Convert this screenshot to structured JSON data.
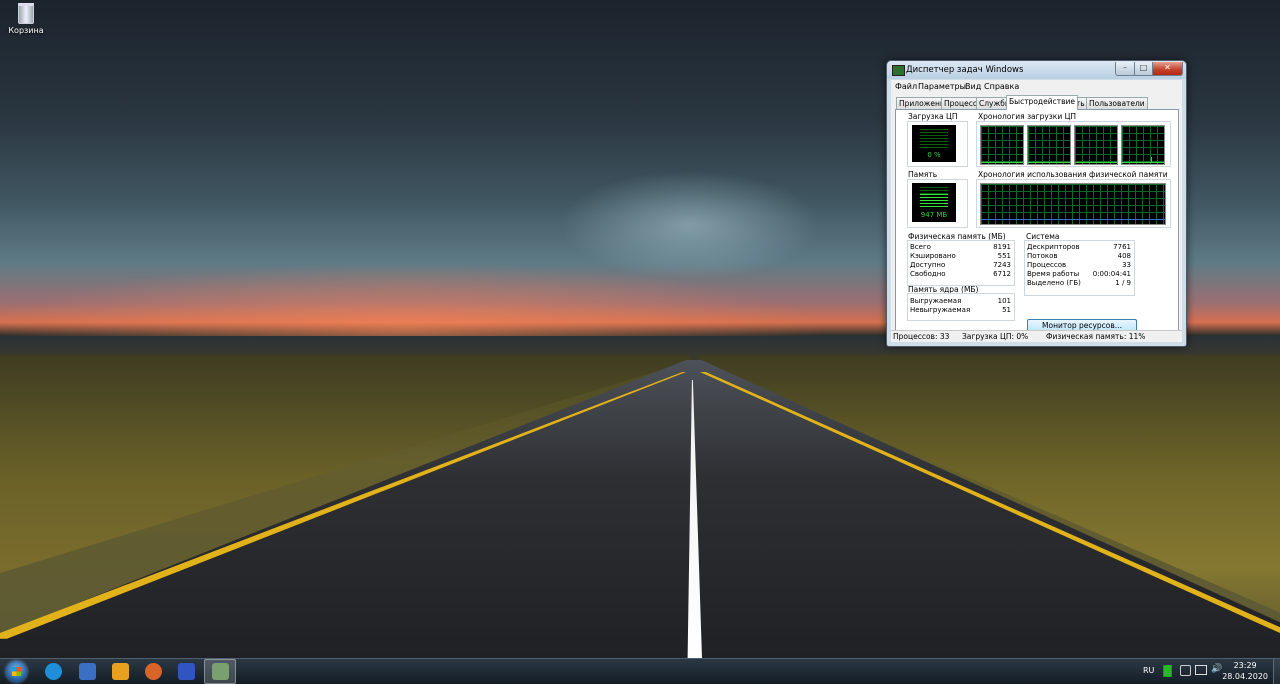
{
  "desktop": {
    "icons": [
      {
        "label": "Корзина",
        "icon": "recycle-bin-icon"
      }
    ]
  },
  "task_manager": {
    "title": "Диспетчер задач Windows",
    "window_controls": {
      "minimize": "–",
      "maximize": "□",
      "close": "✕"
    },
    "menu": [
      "Файл",
      "Параметры",
      "Вид",
      "Справка"
    ],
    "tabs": [
      "Приложения",
      "Процессы",
      "Службы",
      "Быстродействие",
      "Сеть",
      "Пользователи"
    ],
    "active_tab": "Быстродействие",
    "cpu": {
      "title": "Загрузка ЦП",
      "value": "0 %",
      "fraction": 0.0
    },
    "cpu_history": {
      "title": "Хронология загрузки ЦП",
      "cores": 4
    },
    "memory": {
      "title": "Память",
      "value": "947 МБ",
      "fraction": 0.11
    },
    "memory_history": {
      "title": "Хронология использования физической памяти"
    },
    "physical_memory": {
      "title": "Физическая память (МБ)",
      "rows": [
        {
          "label": "Всего",
          "value": "8191"
        },
        {
          "label": "Кэшировано",
          "value": "551"
        },
        {
          "label": "Доступно",
          "value": "7243"
        },
        {
          "label": "Свободно",
          "value": "6712"
        }
      ]
    },
    "kernel_memory": {
      "title": "Память ядра (МБ)",
      "rows": [
        {
          "label": "Выгружаемая",
          "value": "101"
        },
        {
          "label": "Невыгружаемая",
          "value": "51"
        }
      ]
    },
    "system": {
      "title": "Система",
      "rows": [
        {
          "label": "Дескрипторов",
          "value": "7761"
        },
        {
          "label": "Потоков",
          "value": "408"
        },
        {
          "label": "Процессов",
          "value": "33"
        },
        {
          "label": "Время работы",
          "value": "0:00:04:41"
        },
        {
          "label": "Выделено (ГБ)",
          "value": "1 / 9"
        }
      ]
    },
    "resource_monitor_button": "Монитор ресурсов...",
    "status": {
      "processes": "Процессов: 33",
      "cpu": "Загрузка ЦП: 0%",
      "memory": "Физическая память: 11%"
    }
  },
  "taskbar": {
    "pinned": [
      {
        "name": "edge",
        "icon": "edge-icon",
        "color": "#1e8fd8"
      },
      {
        "name": "calendar",
        "icon": "calendar-app-icon",
        "color": "#3a6fc4"
      },
      {
        "name": "photos",
        "icon": "sunflower-icon",
        "color": "#e8a020"
      },
      {
        "name": "paint",
        "icon": "paint-icon",
        "color": "#d9642a"
      },
      {
        "name": "save",
        "icon": "floppy-icon",
        "color": "#2f56c0"
      },
      {
        "name": "task-manager",
        "icon": "task-manager-icon",
        "color": "#7aa070",
        "active": true
      }
    ],
    "language": "RU",
    "clock_time": "23:29",
    "clock_date": "28.04.2020"
  }
}
